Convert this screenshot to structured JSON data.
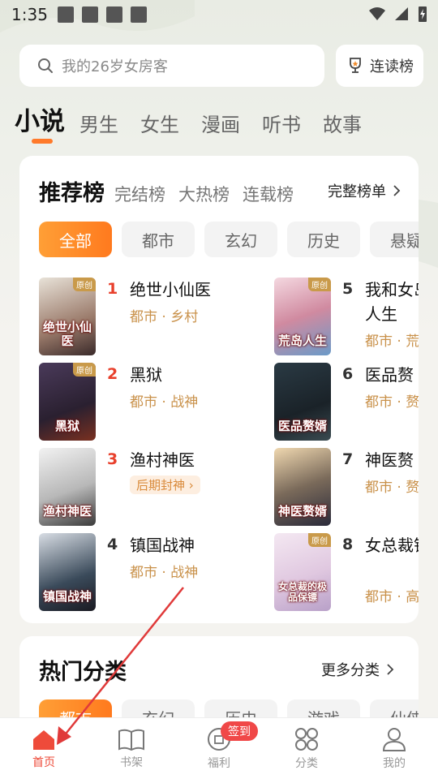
{
  "status_bar": {
    "time": "1:35"
  },
  "search": {
    "placeholder": "我的26岁女房客"
  },
  "rank_button": {
    "label": "连读榜"
  },
  "top_nav": [
    {
      "label": "小说",
      "active": true
    },
    {
      "label": "男生"
    },
    {
      "label": "女生"
    },
    {
      "label": "漫画"
    },
    {
      "label": "听书"
    },
    {
      "label": "故事"
    }
  ],
  "rank_card": {
    "tabs": [
      "推荐榜",
      "完结榜",
      "大热榜",
      "连载榜"
    ],
    "full_rank": "完整榜单",
    "chips": [
      "全部",
      "都市",
      "玄幻",
      "历史",
      "悬疑"
    ],
    "books": [
      {
        "rank": "1",
        "title": "绝世小仙医",
        "tag": "都市 · 乡村",
        "cover_text": "绝世小仙医",
        "badge": "原创"
      },
      {
        "rank": "2",
        "title": "黑狱",
        "tag": "都市 · 战神",
        "cover_text": "黑狱",
        "badge": "原创"
      },
      {
        "rank": "3",
        "title": "渔村神医",
        "tag": "后期封神 ›",
        "cover_text": "渔村神医"
      },
      {
        "rank": "4",
        "title": "镇国战神",
        "tag": "都市 · 战神",
        "cover_text": "镇国战神"
      },
      {
        "rank": "5",
        "title": "我和女岛人生",
        "tag": "都市 · 荒",
        "cover_text": "荒岛人生",
        "badge": "原创"
      },
      {
        "rank": "6",
        "title": "医品赘",
        "tag": "都市 · 赘",
        "cover_text": "医品赘婿"
      },
      {
        "rank": "7",
        "title": "神医赘",
        "tag": "都市 · 赘",
        "cover_text": "神医赘婿"
      },
      {
        "rank": "8",
        "title": "女总裁镖",
        "tag": "都市 · 高",
        "cover_text": "女总裁的极品保镖",
        "badge": "原创"
      }
    ]
  },
  "hot_section": {
    "title": "热门分类",
    "more": "更多分类",
    "chips": [
      "都市",
      "玄幻",
      "历史",
      "游戏",
      "仙侠"
    ]
  },
  "bottom_nav": [
    {
      "label": "首页",
      "active": true
    },
    {
      "label": "书架"
    },
    {
      "label": "福利",
      "badge": "签到"
    },
    {
      "label": "分类"
    },
    {
      "label": "我的"
    }
  ],
  "colors": {
    "accent": "#ff7a2b",
    "rank_top": "#e8402c",
    "tag": "#c9914a",
    "tab_active": "#ee4b3a"
  }
}
